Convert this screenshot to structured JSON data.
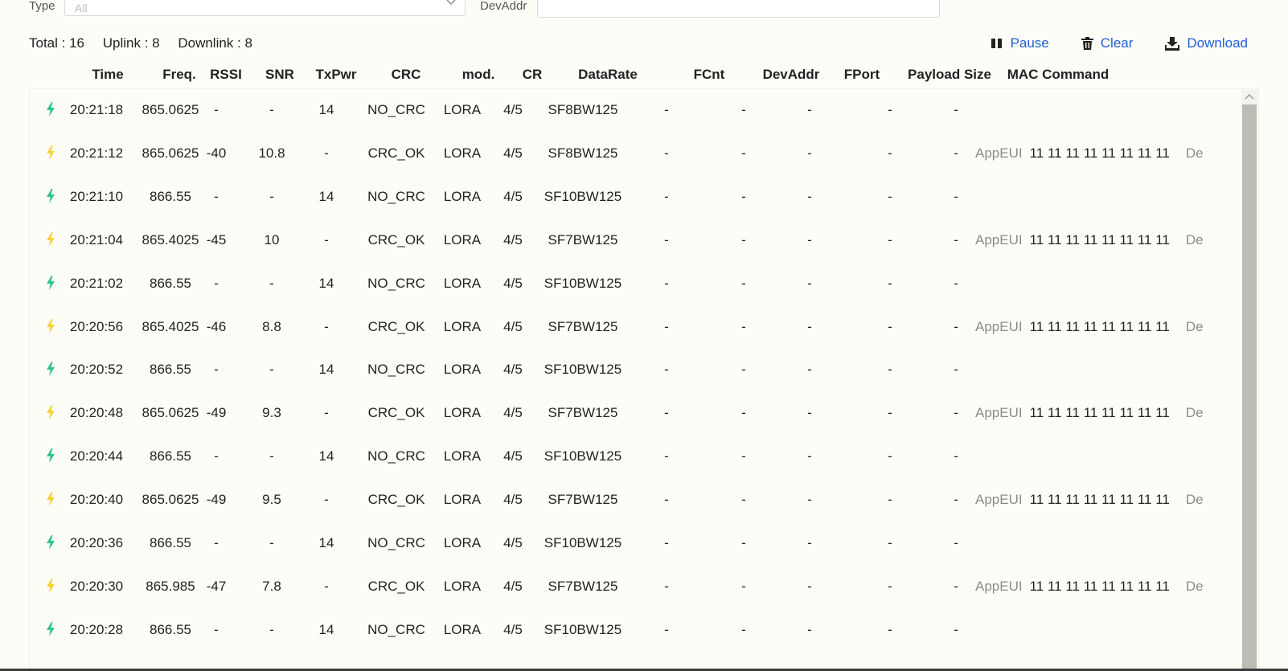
{
  "filters": {
    "type_label": "Type",
    "type_value": "All",
    "devaddr_label": "DevAddr",
    "devaddr_value": ""
  },
  "stats": {
    "total": "Total : 16",
    "uplink": "Uplink : 8",
    "downlink": "Downlink : 8"
  },
  "actions": {
    "pause": "Pause",
    "clear": "Clear",
    "download": "Download"
  },
  "colors": {
    "accent": "#1f5fd6",
    "uplink_icon": "#f5d33a",
    "downlink_icon": "#2fc58a"
  },
  "icons": {
    "pause": "pause-icon",
    "clear": "trash-icon",
    "download": "download-icon",
    "row": "lightning-icon"
  },
  "table": {
    "columns": [
      "Time",
      "Freq.",
      "RSSI",
      "SNR",
      "TxPwr",
      "CRC",
      "mod.",
      "CR",
      "DataRate",
      "FCnt",
      "DevAddr",
      "FPort",
      "Payload Size",
      "MAC Command"
    ],
    "rows": [
      {
        "dir": "down",
        "time": "20:21:18",
        "freq": "865.0625",
        "rssi": "-",
        "snr": "-",
        "txpwr": "14",
        "crc": "NO_CRC",
        "mod": "LORA",
        "cr": "4/5",
        "datarate": "SF8BW125",
        "fcnt": "-",
        "devaddr": "-",
        "fport": "-",
        "payload": "-",
        "mac": "-",
        "mac_key": "",
        "mac_val": "",
        "mac_next": ""
      },
      {
        "dir": "up",
        "time": "20:21:12",
        "freq": "865.0625",
        "rssi": "-40",
        "snr": "10.8",
        "txpwr": "-",
        "crc": "CRC_OK",
        "mod": "LORA",
        "cr": "4/5",
        "datarate": "SF8BW125",
        "fcnt": "-",
        "devaddr": "-",
        "fport": "-",
        "payload": "-",
        "mac": "-",
        "mac_key": "AppEUI",
        "mac_val": "11 11 11 11 11 11 11 11",
        "mac_next": "De"
      },
      {
        "dir": "down",
        "time": "20:21:10",
        "freq": "866.55",
        "rssi": "-",
        "snr": "-",
        "txpwr": "14",
        "crc": "NO_CRC",
        "mod": "LORA",
        "cr": "4/5",
        "datarate": "SF10BW125",
        "fcnt": "-",
        "devaddr": "-",
        "fport": "-",
        "payload": "-",
        "mac": "-",
        "mac_key": "",
        "mac_val": "",
        "mac_next": ""
      },
      {
        "dir": "up",
        "time": "20:21:04",
        "freq": "865.4025",
        "rssi": "-45",
        "snr": "10",
        "txpwr": "-",
        "crc": "CRC_OK",
        "mod": "LORA",
        "cr": "4/5",
        "datarate": "SF7BW125",
        "fcnt": "-",
        "devaddr": "-",
        "fport": "-",
        "payload": "-",
        "mac": "-",
        "mac_key": "AppEUI",
        "mac_val": "11 11 11 11 11 11 11 11",
        "mac_next": "De"
      },
      {
        "dir": "down",
        "time": "20:21:02",
        "freq": "866.55",
        "rssi": "-",
        "snr": "-",
        "txpwr": "14",
        "crc": "NO_CRC",
        "mod": "LORA",
        "cr": "4/5",
        "datarate": "SF10BW125",
        "fcnt": "-",
        "devaddr": "-",
        "fport": "-",
        "payload": "-",
        "mac": "-",
        "mac_key": "",
        "mac_val": "",
        "mac_next": ""
      },
      {
        "dir": "up",
        "time": "20:20:56",
        "freq": "865.4025",
        "rssi": "-46",
        "snr": "8.8",
        "txpwr": "-",
        "crc": "CRC_OK",
        "mod": "LORA",
        "cr": "4/5",
        "datarate": "SF7BW125",
        "fcnt": "-",
        "devaddr": "-",
        "fport": "-",
        "payload": "-",
        "mac": "-",
        "mac_key": "AppEUI",
        "mac_val": "11 11 11 11 11 11 11 11",
        "mac_next": "De"
      },
      {
        "dir": "down",
        "time": "20:20:52",
        "freq": "866.55",
        "rssi": "-",
        "snr": "-",
        "txpwr": "14",
        "crc": "NO_CRC",
        "mod": "LORA",
        "cr": "4/5",
        "datarate": "SF10BW125",
        "fcnt": "-",
        "devaddr": "-",
        "fport": "-",
        "payload": "-",
        "mac": "-",
        "mac_key": "",
        "mac_val": "",
        "mac_next": ""
      },
      {
        "dir": "up",
        "time": "20:20:48",
        "freq": "865.0625",
        "rssi": "-49",
        "snr": "9.3",
        "txpwr": "-",
        "crc": "CRC_OK",
        "mod": "LORA",
        "cr": "4/5",
        "datarate": "SF7BW125",
        "fcnt": "-",
        "devaddr": "-",
        "fport": "-",
        "payload": "-",
        "mac": "-",
        "mac_key": "AppEUI",
        "mac_val": "11 11 11 11 11 11 11 11",
        "mac_next": "De"
      },
      {
        "dir": "down",
        "time": "20:20:44",
        "freq": "866.55",
        "rssi": "-",
        "snr": "-",
        "txpwr": "14",
        "crc": "NO_CRC",
        "mod": "LORA",
        "cr": "4/5",
        "datarate": "SF10BW125",
        "fcnt": "-",
        "devaddr": "-",
        "fport": "-",
        "payload": "-",
        "mac": "-",
        "mac_key": "",
        "mac_val": "",
        "mac_next": ""
      },
      {
        "dir": "up",
        "time": "20:20:40",
        "freq": "865.0625",
        "rssi": "-49",
        "snr": "9.5",
        "txpwr": "-",
        "crc": "CRC_OK",
        "mod": "LORA",
        "cr": "4/5",
        "datarate": "SF7BW125",
        "fcnt": "-",
        "devaddr": "-",
        "fport": "-",
        "payload": "-",
        "mac": "-",
        "mac_key": "AppEUI",
        "mac_val": "11 11 11 11 11 11 11 11",
        "mac_next": "De"
      },
      {
        "dir": "down",
        "time": "20:20:36",
        "freq": "866.55",
        "rssi": "-",
        "snr": "-",
        "txpwr": "14",
        "crc": "NO_CRC",
        "mod": "LORA",
        "cr": "4/5",
        "datarate": "SF10BW125",
        "fcnt": "-",
        "devaddr": "-",
        "fport": "-",
        "payload": "-",
        "mac": "-",
        "mac_key": "",
        "mac_val": "",
        "mac_next": ""
      },
      {
        "dir": "up",
        "time": "20:20:30",
        "freq": "865.985",
        "rssi": "-47",
        "snr": "7.8",
        "txpwr": "-",
        "crc": "CRC_OK",
        "mod": "LORA",
        "cr": "4/5",
        "datarate": "SF7BW125",
        "fcnt": "-",
        "devaddr": "-",
        "fport": "-",
        "payload": "-",
        "mac": "-",
        "mac_key": "AppEUI",
        "mac_val": "11 11 11 11 11 11 11 11",
        "mac_next": "De"
      },
      {
        "dir": "down",
        "time": "20:20:28",
        "freq": "866.55",
        "rssi": "-",
        "snr": "-",
        "txpwr": "14",
        "crc": "NO_CRC",
        "mod": "LORA",
        "cr": "4/5",
        "datarate": "SF10BW125",
        "fcnt": "-",
        "devaddr": "-",
        "fport": "-",
        "payload": "-",
        "mac": "-",
        "mac_key": "",
        "mac_val": "",
        "mac_next": ""
      }
    ]
  }
}
